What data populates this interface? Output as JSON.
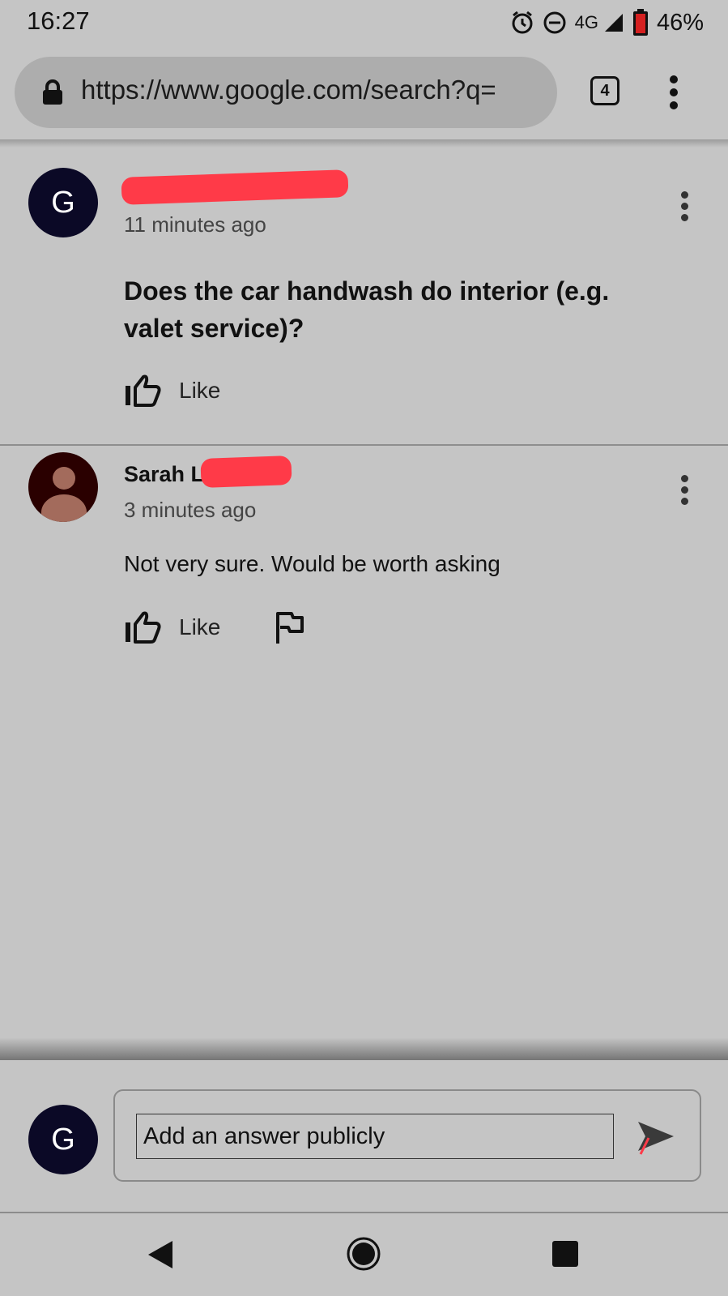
{
  "status_bar": {
    "time": "16:27",
    "network": "4G",
    "battery": "46%"
  },
  "browser": {
    "url": "https://www.google.com/search?q=",
    "tab_count": "4"
  },
  "comments": [
    {
      "avatar_letter": "G",
      "author": "",
      "author_redacted": true,
      "timestamp": "11 minutes ago",
      "text": "Does the car handwash do interior (e.g. valet service)?",
      "like_label": "Like"
    },
    {
      "avatar_letter": "",
      "author": "Sarah L",
      "author_redacted": true,
      "timestamp": "3 minutes ago",
      "text": "Not very sure. Would be worth asking",
      "like_label": "Like"
    }
  ],
  "composer": {
    "avatar_letter": "G",
    "placeholder": "Add an answer publicly"
  },
  "colors": {
    "background": "#c5c5c5",
    "avatar_bg": "#0b0926",
    "redaction": "#ff3a48"
  },
  "icons": [
    "lock-icon",
    "alarm-icon",
    "dnd-icon",
    "signal-icon",
    "battery-icon",
    "more-vert-icon",
    "thumbs-up-icon",
    "flag-icon",
    "send-icon",
    "back-icon",
    "home-icon",
    "recents-icon"
  ]
}
